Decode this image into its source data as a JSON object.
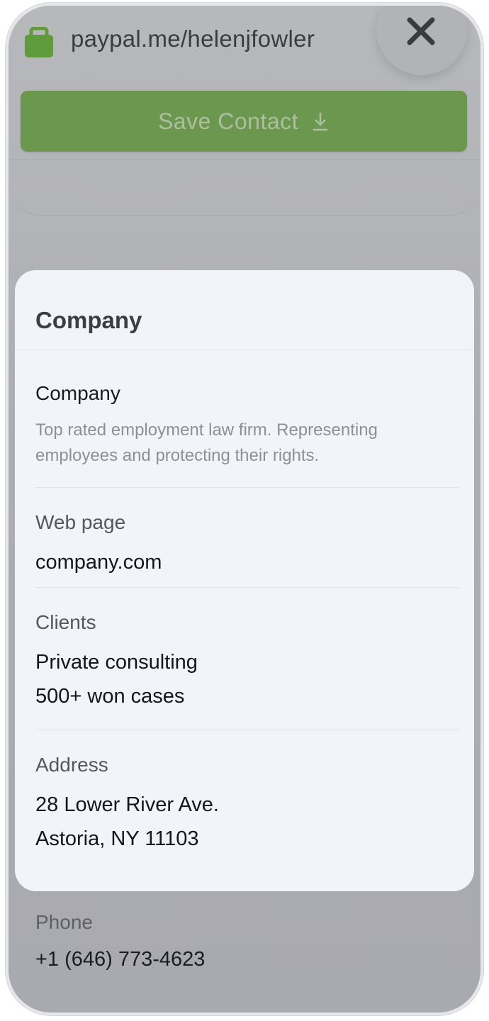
{
  "url_bar": {
    "url": "paypal.me/helenjfowler",
    "lock_icon": "briefcase-icon",
    "icon_color": "#5f9a3c"
  },
  "close_button": {
    "icon": "close-icon"
  },
  "save_button": {
    "label": "Save Contact",
    "icon": "download-icon",
    "color": "#6c974e"
  },
  "sheet": {
    "title": "Company",
    "sections": {
      "company": {
        "label": "Company",
        "description": "Top rated employment law firm. Representing employees and protecting their rights."
      },
      "web_page": {
        "label": "Web page",
        "value": "company.com"
      },
      "clients": {
        "label": "Clients",
        "values": [
          "Private consulting",
          "500+ won cases"
        ]
      },
      "address": {
        "label": "Address",
        "values": [
          "28 Lower River Ave.",
          "Astoria, NY 11103"
        ]
      }
    }
  },
  "background": {
    "phone": {
      "label": "Phone",
      "value": "+1 (646) 773-4623"
    }
  }
}
